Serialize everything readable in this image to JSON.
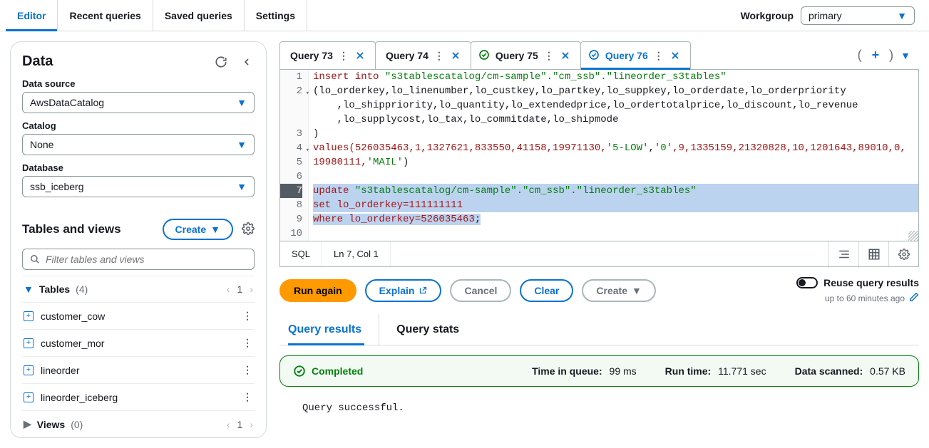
{
  "top_tabs": [
    "Editor",
    "Recent queries",
    "Saved queries",
    "Settings"
  ],
  "workgroup": {
    "label": "Workgroup",
    "value": "primary"
  },
  "data_panel": {
    "title": "Data",
    "data_source": {
      "label": "Data source",
      "value": "AwsDataCatalog"
    },
    "catalog": {
      "label": "Catalog",
      "value": "None"
    },
    "database": {
      "label": "Database",
      "value": "ssb_iceberg"
    },
    "tables_title": "Tables and views",
    "create_label": "Create",
    "filter_placeholder": "Filter tables and views",
    "tables_category": {
      "label": "Tables",
      "count": "(4)",
      "page": "1"
    },
    "tables": [
      "customer_cow",
      "customer_mor",
      "lineorder",
      "lineorder_iceberg"
    ],
    "views_category": {
      "label": "Views",
      "count": "(0)",
      "page": "1"
    }
  },
  "query_tabs": [
    {
      "title": "Query 73",
      "status": "none"
    },
    {
      "title": "Query 74",
      "status": "none"
    },
    {
      "title": "Query 75",
      "status": "ok"
    },
    {
      "title": "Query 76",
      "status": "ok",
      "active": true
    }
  ],
  "editor_lines": {
    "l1": {
      "pre": "insert into ",
      "str": "\"s3tablescatalog/cm-sample\".\"cm_ssb\".\"lineorder_s3tables\""
    },
    "l2": "(lo_orderkey,lo_linenumber,lo_custkey,lo_partkey,lo_suppkey,lo_orderdate,lo_orderpriority",
    "l2b": "    ,lo_shippriority,lo_quantity,lo_extendedprice,lo_ordertotalprice,lo_discount,lo_revenue",
    "l2c": "    ,lo_supplycost,lo_tax,lo_commitdate,lo_shipmode",
    "l3": ")",
    "l4a": "values(",
    "l4b": "526035463,1,1327621,833550,41158,19971130,",
    "l4c": "'5-LOW'",
    "l4d": ",",
    "l4e": "'0'",
    "l4f": ",9,1335159,21320828,10,1201643,89010,0,",
    "l5a": "19980111,",
    "l5b": "'MAIL'",
    "l5c": ")",
    "l7a": "update ",
    "l7b": "\"s3tablescatalog/cm-sample\".\"cm_ssb\".\"lineorder_s3tables\"",
    "l8a": "set lo_orderkey=",
    "l8b": "111111111",
    "l9a": "where lo_orderkey=",
    "l9b": "526035463",
    "l9c": ";"
  },
  "status_bar": {
    "lang": "SQL",
    "pos": "Ln 7, Col 1"
  },
  "action_buttons": {
    "run": "Run again",
    "explain": "Explain",
    "cancel": "Cancel",
    "clear": "Clear",
    "create": "Create"
  },
  "reuse": {
    "label": "Reuse query results",
    "sub": "up to 60 minutes ago"
  },
  "results_tabs": [
    "Query results",
    "Query stats"
  ],
  "banner": {
    "status": "Completed",
    "queue_label": "Time in queue:",
    "queue_val": "99 ms",
    "run_label": "Run time:",
    "run_val": "11.771 sec",
    "scan_label": "Data scanned:",
    "scan_val": "0.57 KB"
  },
  "result_message": "Query successful."
}
